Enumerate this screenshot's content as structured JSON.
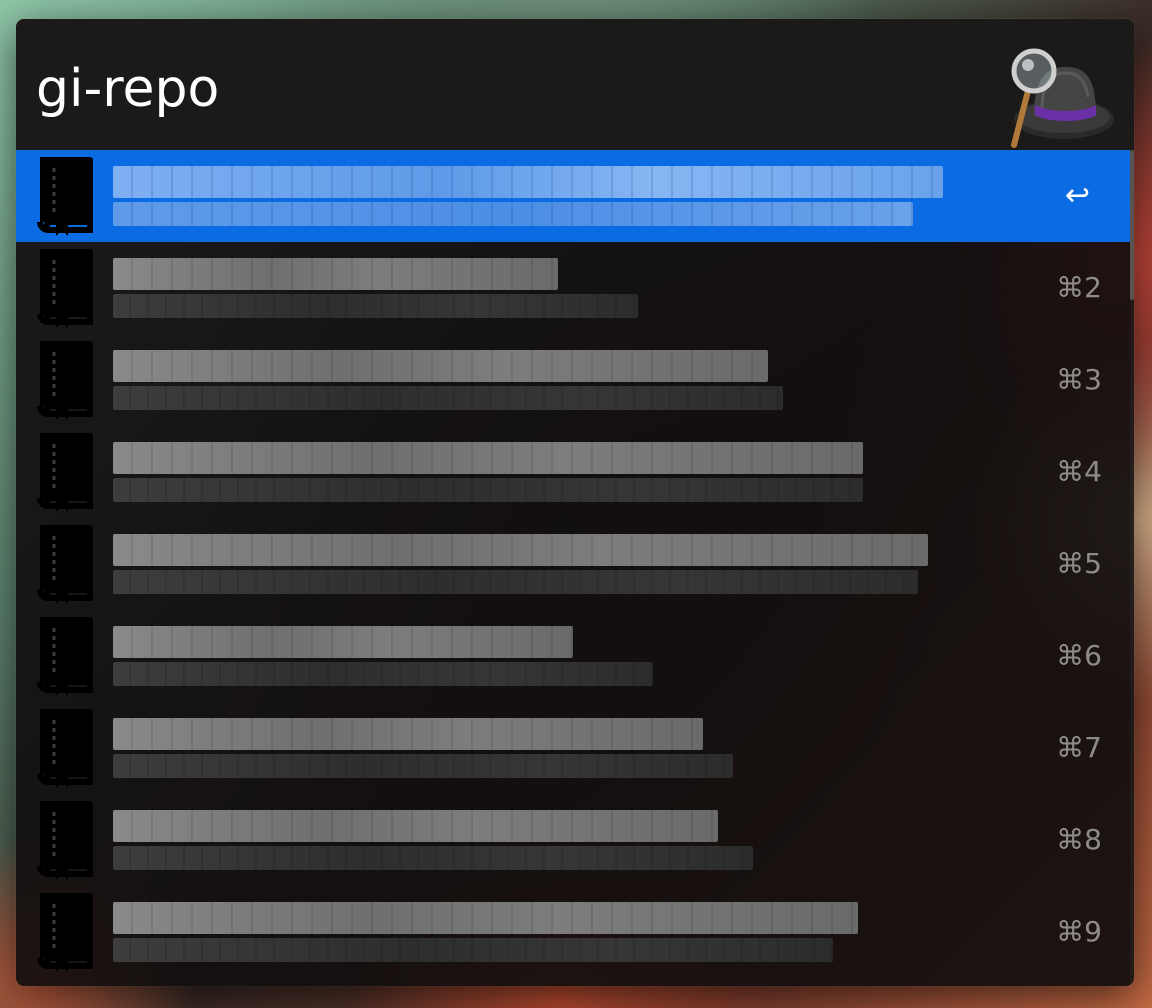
{
  "search": {
    "query": "gi-repo"
  },
  "app": {
    "logo_icon": "alfred-hat-magnifier-icon"
  },
  "results": [
    {
      "icon": "repo-book-icon",
      "title": "",
      "subtitle": "",
      "shortcut": "↩",
      "selected": true
    },
    {
      "icon": "repo-book-icon",
      "title": "",
      "subtitle": "",
      "shortcut": "⌘2",
      "selected": false
    },
    {
      "icon": "repo-book-icon",
      "title": "",
      "subtitle": "",
      "shortcut": "⌘3",
      "selected": false
    },
    {
      "icon": "repo-book-icon",
      "title": "",
      "subtitle": "",
      "shortcut": "⌘4",
      "selected": false
    },
    {
      "icon": "repo-book-icon",
      "title": "",
      "subtitle": "",
      "shortcut": "⌘5",
      "selected": false
    },
    {
      "icon": "repo-book-icon",
      "title": "",
      "subtitle": "",
      "shortcut": "⌘6",
      "selected": false
    },
    {
      "icon": "repo-book-icon",
      "title": "",
      "subtitle": "",
      "shortcut": "⌘7",
      "selected": false
    },
    {
      "icon": "repo-book-icon",
      "title": "",
      "subtitle": "",
      "shortcut": "⌘8",
      "selected": false
    },
    {
      "icon": "repo-book-icon",
      "title": "",
      "subtitle": "",
      "shortcut": "⌘9",
      "selected": false
    }
  ],
  "colors": {
    "selection": "#0a6be3",
    "window_bg": "#1b1a19",
    "shortcut_text": "#8e8c8a",
    "hat_band": "#6b2fa8"
  }
}
